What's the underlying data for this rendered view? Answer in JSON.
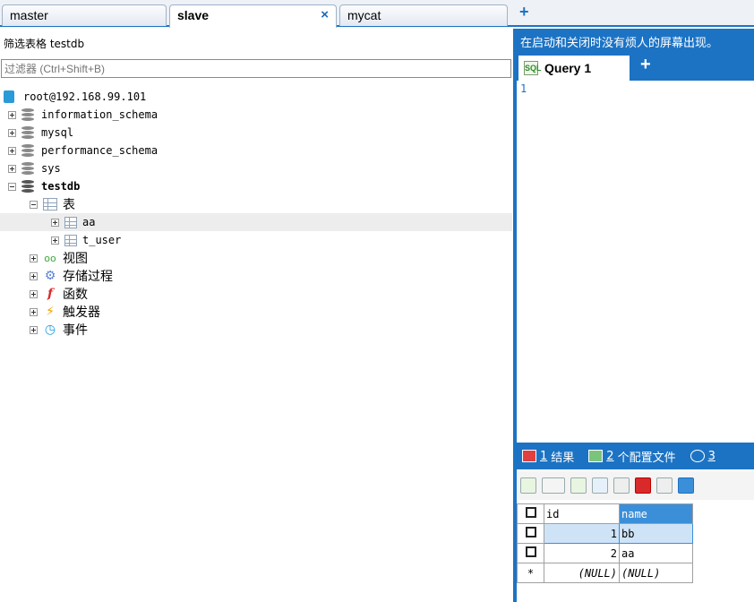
{
  "tabs": [
    {
      "label": "master"
    },
    {
      "label": "slave",
      "close": "×"
    },
    {
      "label": "mycat"
    }
  ],
  "tab_add": "+",
  "filter": {
    "label": "筛选表格 testdb",
    "placeholder": "过滤器 (Ctrl+Shift+B)"
  },
  "tree": {
    "connection": "root@192.168.99.101",
    "databases": [
      "information_schema",
      "mysql",
      "performance_schema",
      "sys",
      "testdb"
    ],
    "tables_folder": "表",
    "tables": [
      "aa",
      "t_user"
    ],
    "folders": [
      "视图",
      "存储过程",
      "函数",
      "触发器",
      "事件"
    ]
  },
  "right": {
    "info": "在启动和关闭时没有烦人的屏幕出现。",
    "query_tab": "Query 1",
    "query_add": "+",
    "editor_line": "1",
    "result_tabs": [
      {
        "num": "1",
        "label": "结果"
      },
      {
        "num": "2",
        "label": "个配置文件"
      },
      {
        "num": "3",
        "label": ""
      }
    ]
  },
  "grid": {
    "columns": [
      "id",
      "name"
    ],
    "rows": [
      {
        "id": "1",
        "name": "bb"
      },
      {
        "id": "2",
        "name": "aa"
      }
    ],
    "new_row_marker": "*",
    "null_text": "(NULL)"
  },
  "colors": {
    "accent": "#1c73c4",
    "header_blue": "#3b8fd9"
  }
}
